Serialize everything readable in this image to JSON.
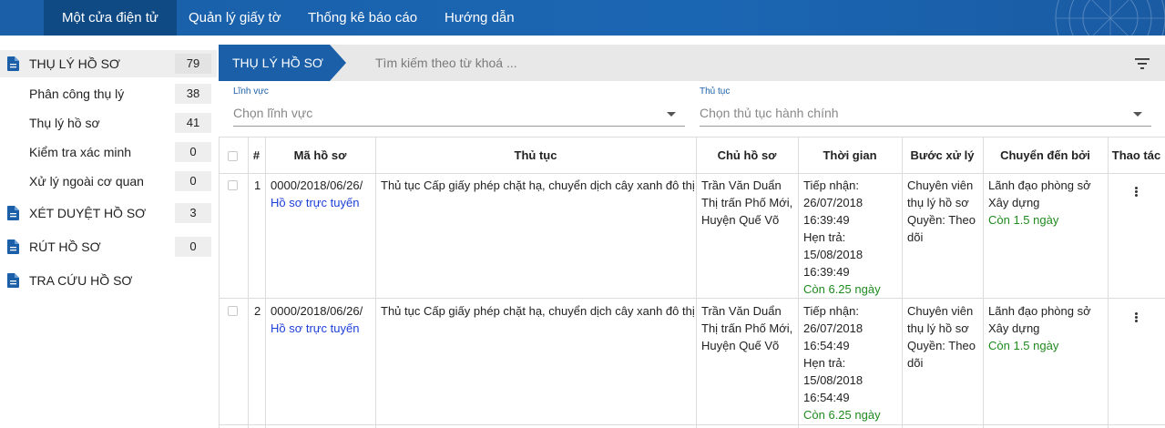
{
  "nav": {
    "items": [
      {
        "label": "Một cửa điện tử",
        "active": true
      },
      {
        "label": "Quản lý giấy tờ",
        "active": false
      },
      {
        "label": "Thống kê báo cáo",
        "active": false
      },
      {
        "label": "Hướng dẫn",
        "active": false
      }
    ]
  },
  "sidebar": {
    "items": [
      {
        "label": "THỤ LÝ HỒ SƠ",
        "count": "79",
        "icon": "document-icon"
      },
      {
        "label": "Phân công thụ lý",
        "count": "38"
      },
      {
        "label": "Thụ lý hồ sơ",
        "count": "41"
      },
      {
        "label": "Kiểm tra xác minh",
        "count": "0"
      },
      {
        "label": "Xử lý ngoài cơ quan",
        "count": "0"
      },
      {
        "label": "XÉT DUYỆT HỒ SƠ",
        "count": "3",
        "icon": "document-icon"
      },
      {
        "label": "RÚT HỒ SƠ",
        "count": "0",
        "icon": "document-icon"
      },
      {
        "label": "TRA CỨU HỒ SƠ",
        "icon": "document-icon"
      }
    ]
  },
  "header": {
    "tab_label": "THỤ LÝ HỒ SƠ",
    "search_placeholder": "Tìm kiếm theo từ khoá ...",
    "filter_icon": "filter-icon"
  },
  "filters": {
    "field": {
      "label": "Lĩnh vực",
      "placeholder": "Chọn lĩnh vực"
    },
    "procedure": {
      "label": "Thủ tục",
      "placeholder": "Chọn thủ tục hành chính"
    }
  },
  "table": {
    "headers": [
      "#",
      "Mã hồ sơ",
      "Thủ tục",
      "Chủ hồ sơ",
      "Thời gian",
      "Bước xử lý",
      "Chuyển đến bởi",
      "Thao tác"
    ],
    "rows": [
      {
        "index": "1",
        "code": "0000/2018/06/26/",
        "code_link": "Hồ sơ trực tuyến",
        "procedure": "Thủ tục Cấp giấy phép chặt hạ, chuyển dịch cây xanh đô thị",
        "owner": [
          "Trần Văn Duẩn",
          "Thị trấn Phố Mới,",
          "Huyện Quế Võ"
        ],
        "time": [
          "Tiếp nhận:",
          "26/07/2018",
          "16:39:49",
          "Hẹn trả:",
          "15/08/2018",
          "16:39:49"
        ],
        "time_remaining": "Còn 6.25 ngày",
        "step": [
          "Chuyên viên",
          "thụ lý hồ sơ",
          "Quyền: Theo",
          "dõi"
        ],
        "from": [
          "Lãnh đạo phòng sở",
          "Xây dựng"
        ],
        "from_remaining": "Còn 1.5 ngày"
      },
      {
        "index": "2",
        "code": "0000/2018/06/26/",
        "code_link": "Hồ sơ trực tuyến",
        "procedure": "Thủ tục Cấp giấy phép chặt hạ, chuyển dịch cây xanh đô thị",
        "owner": [
          "Trần Văn Duẩn",
          "Thị trấn Phố Mới,",
          "Huyện Quế Võ"
        ],
        "time": [
          "Tiếp nhận:",
          "26/07/2018",
          "16:54:49",
          "Hẹn trả:",
          "15/08/2018",
          "16:54:49"
        ],
        "time_remaining": "Còn 6.25 ngày",
        "step": [
          "Chuyên viên",
          "thụ lý hồ sơ",
          "Quyền: Theo",
          "dõi"
        ],
        "from": [
          "Lãnh đạo phòng sở",
          "Xây dựng"
        ],
        "from_remaining": "Còn 1.5 ngày"
      }
    ]
  },
  "colors": {
    "nav_bg": "#1b66b3",
    "nav_active": "#0f4a85",
    "link": "#1d3fd8",
    "remaining": "#1f8a1f",
    "accent": "#1a5fa8"
  }
}
